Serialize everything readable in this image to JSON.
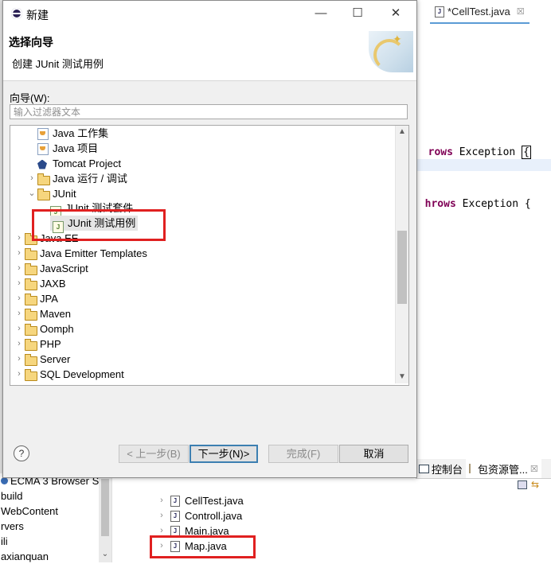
{
  "editor": {
    "tab_label": "*CellTest.java",
    "tab_close": "☒",
    "code_lines": [
      {
        "kw": "rows",
        "rest": " Exception ",
        "cursor": "{"
      },
      {
        "kw": "hrows",
        "rest": " Exception {",
        "cursor": ""
      }
    ]
  },
  "dialog": {
    "title": "新建",
    "minimize": "—",
    "maximize": "☐",
    "close": "✕",
    "header_title": "选择向导",
    "header_subtitle": "创建 JUnit 测试用例",
    "wizard_label": "向导(W):",
    "filter_placeholder": "输入过滤器文本",
    "tree": [
      {
        "label": "Java 工作集",
        "icon": "java-icon",
        "arrow": ""
      },
      {
        "label": "Java 项目",
        "icon": "java-project-icon",
        "arrow": ""
      },
      {
        "label": "Tomcat Project",
        "icon": "tomcat-icon",
        "arrow": ""
      },
      {
        "label": "Java 运行 / 调试",
        "icon": "folder-icon",
        "arrow": "›"
      },
      {
        "label": "JUnit",
        "icon": "folder-icon",
        "arrow": "⌄"
      },
      {
        "label": "JUnit 测试套件",
        "icon": "junit-icon",
        "arrow": ""
      },
      {
        "label": "JUnit 测试用例",
        "icon": "junit-icon",
        "arrow": ""
      },
      {
        "label": "Java EE",
        "icon": "folder-icon",
        "arrow": "›"
      },
      {
        "label": "Java Emitter Templates",
        "icon": "folder-icon",
        "arrow": "›"
      },
      {
        "label": "JavaScript",
        "icon": "folder-icon",
        "arrow": "›"
      },
      {
        "label": "JAXB",
        "icon": "folder-icon",
        "arrow": "›"
      },
      {
        "label": "JPA",
        "icon": "folder-icon",
        "arrow": "›"
      },
      {
        "label": "Maven",
        "icon": "folder-icon",
        "arrow": "›"
      },
      {
        "label": "Oomph",
        "icon": "folder-icon",
        "arrow": "›"
      },
      {
        "label": "PHP",
        "icon": "folder-icon",
        "arrow": "›"
      },
      {
        "label": "Server",
        "icon": "folder-icon",
        "arrow": "›"
      },
      {
        "label": "SQL Development",
        "icon": "folder-icon",
        "arrow": "›"
      }
    ],
    "scroll_up": "▲",
    "scroll_down": "▼",
    "buttons": {
      "help": "?",
      "back": "< 上一步(B)",
      "next": "下一步(N)>",
      "finish": "完成(F)",
      "cancel": "取消"
    }
  },
  "bottom_views": {
    "console_tab": "控制台",
    "package_tab": "包资源管...",
    "close": "☒"
  },
  "left_panel": {
    "rows": [
      "ECMA 3 Browser S",
      "build",
      "WebContent",
      "rvers",
      "ili",
      "axianquan"
    ]
  },
  "package_tree": {
    "rows": [
      "CellTest.java",
      "Controll.java",
      "Main.java",
      "Map.java"
    ]
  },
  "colors": {
    "highlight_red": "#e02020",
    "keyword": "#7f0055",
    "default_button_border": "#3c7fb1"
  }
}
